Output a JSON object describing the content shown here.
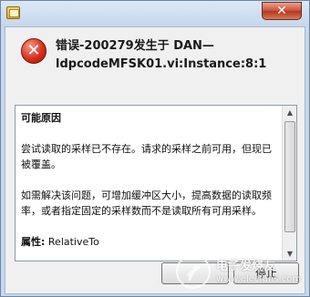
{
  "window": {
    "app_icon": "labview-icon",
    "close_symbol": "✕"
  },
  "error": {
    "icon": "error-icon",
    "icon_symbol": "✕",
    "message": "错误-200279发生于 DAN—ldpcodeMFSK01.vi:Instance:8:1"
  },
  "details": {
    "heading": "可能原因",
    "paragraph1": "尝试读取的采样已不存在。请求的采样之前可用，但现已被覆盖。",
    "paragraph2": "如需解决该问题，可增加缓冲区大小，提高数据的读取频率，或者指定固定的采样数而不是读取所有可用采样。",
    "property_label": "属性:",
    "property_value": "RelativeTo"
  },
  "scrollbar": {
    "up_symbol": "▲",
    "down_symbol": "▼"
  },
  "buttons": {
    "continue_label": "",
    "stop_label": "停止"
  },
  "watermark": {
    "text": "电子发烧友",
    "url": "www.elecfans.com"
  }
}
